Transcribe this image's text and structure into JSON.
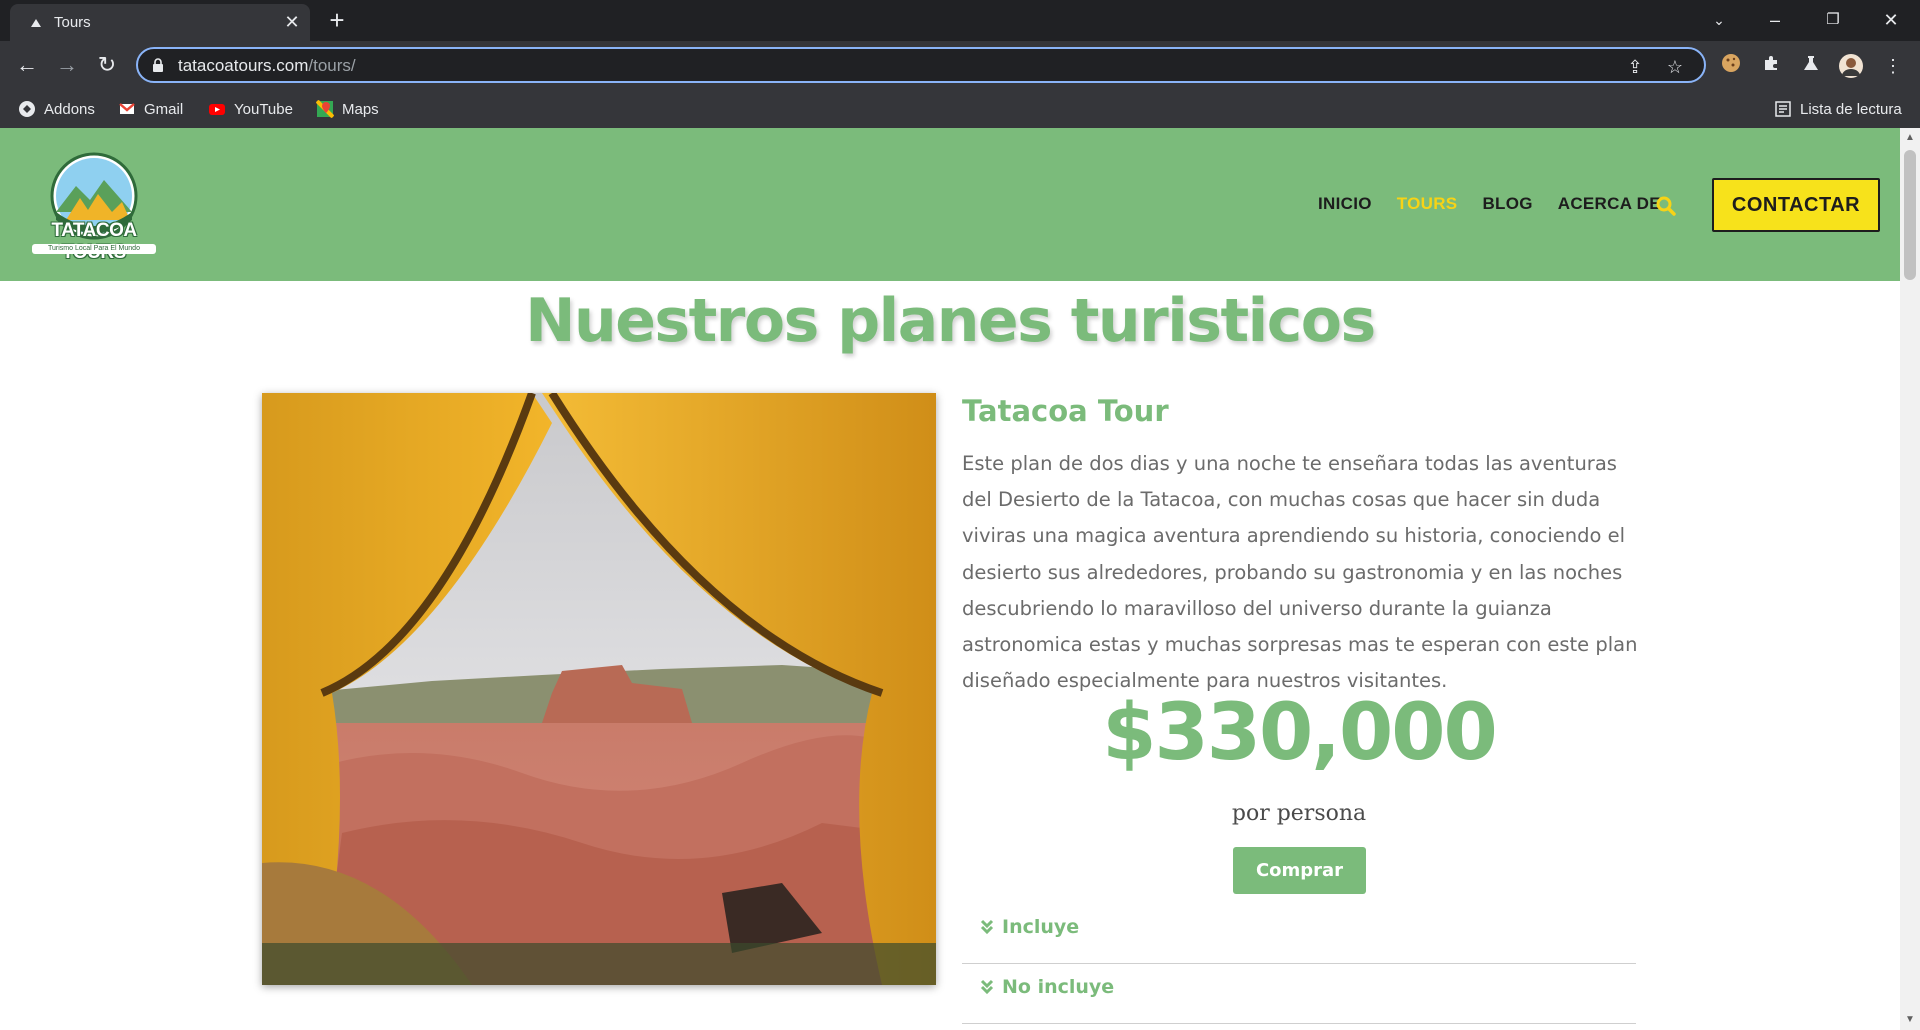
{
  "browser": {
    "tab_title": "Tours",
    "url_host": "tatacoatours.com",
    "url_path": "/tours/",
    "bookmarks": [
      {
        "label": "Addons",
        "icon": "addons-icon"
      },
      {
        "label": "Gmail",
        "icon": "gmail-icon"
      },
      {
        "label": "YouTube",
        "icon": "youtube-icon"
      },
      {
        "label": "Maps",
        "icon": "maps-icon"
      }
    ],
    "reading_list": "Lista de lectura"
  },
  "site": {
    "logo_text": "TATACOA TOURS",
    "logo_tagline": "Turismo Local Para El Mundo",
    "nav": [
      "INICIO",
      "TOURS",
      "BLOG",
      "ACERCA DE"
    ],
    "active_nav": "TOURS",
    "contact_label": "CONTACTAR",
    "colors": {
      "brand_green": "#7bbb7b",
      "accent_yellow": "#f7d316",
      "button_yellow": "#f7e21b"
    }
  },
  "main": {
    "title": "Nuestros planes turisticos",
    "tour": {
      "name": "Tatacoa Tour",
      "description": "Este plan de dos dias y una noche te enseñara todas las aventuras del Desierto de la Tatacoa, con muchas cosas que hacer sin duda viviras una magica aventura aprendiendo su historia, conociendo el desierto sus alrededores, probando su gastronomia y en las noches descubriendo lo maravilloso del universo durante la guianza astronomica estas y muchas sorpresas mas te esperan con este plan diseñado especialmente para nuestros visitantes.",
      "price": "$330,000",
      "price_unit": "por persona",
      "buy_label": "Comprar",
      "accordions": [
        "Incluye",
        "No incluye"
      ]
    }
  }
}
